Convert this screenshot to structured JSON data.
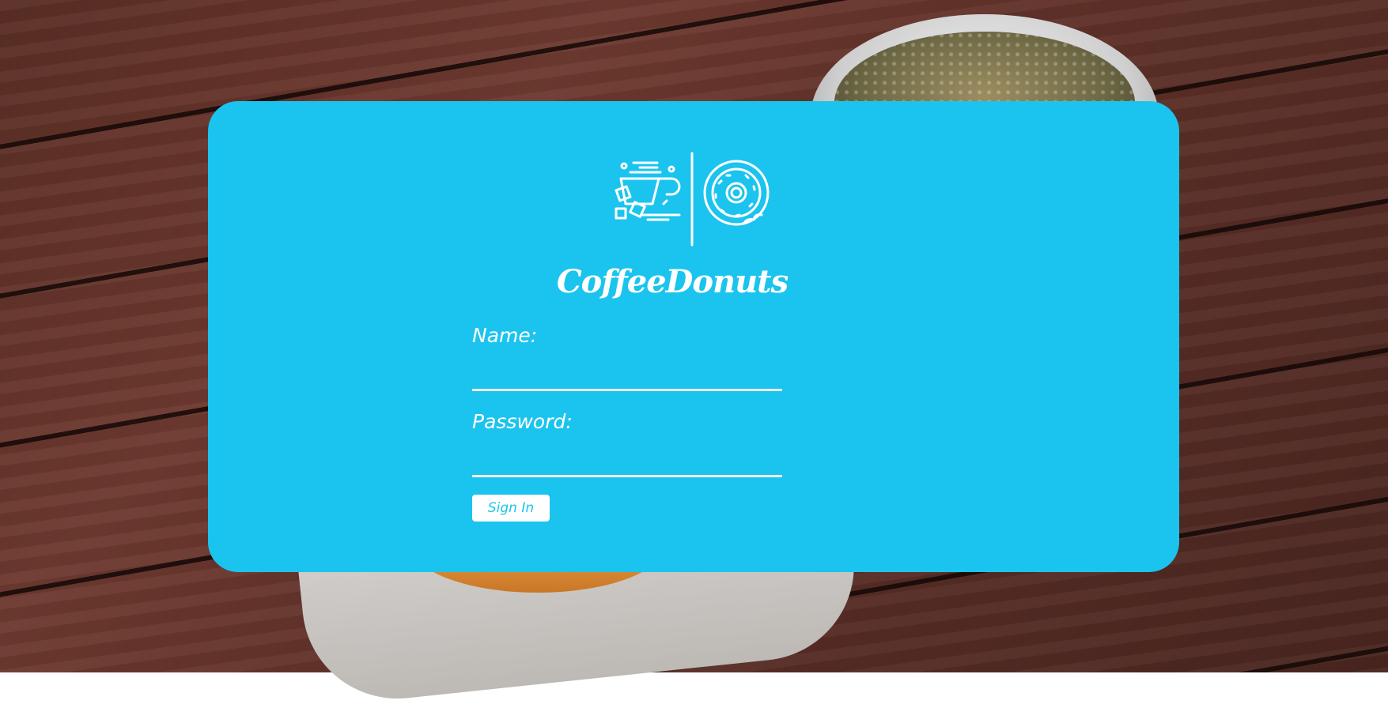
{
  "app": {
    "brand": "CoffeeDonuts"
  },
  "form": {
    "name_label": "Name:",
    "name_value": "",
    "password_label": "Password:",
    "password_value": "",
    "submit_label": "Sign In"
  },
  "logo": {
    "icons": [
      "coffee-cup-icon",
      "donut-icon"
    ]
  },
  "colors": {
    "card": "#1bc4ee",
    "text": "#ffffff",
    "button_bg": "#ffffff",
    "button_text": "#1bc4ee"
  }
}
